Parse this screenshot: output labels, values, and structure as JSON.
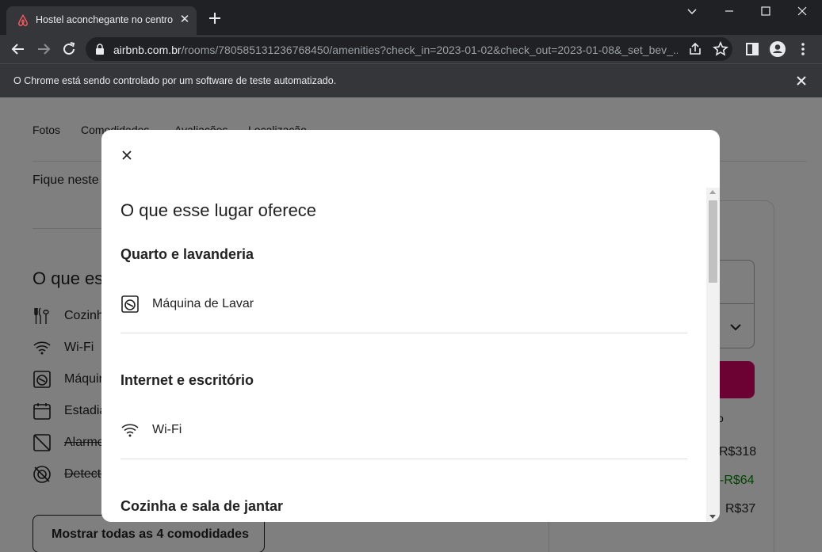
{
  "browser": {
    "tab_title": "Hostel aconchegante no centro h",
    "url_host": "airbnb.com.br",
    "url_path": "/rooms/780585131236768450/amenities?check_in=2023-01-02&check_out=2023-01-08&_set_bev_...",
    "automation_notice": "O Chrome está sendo controlado por um software de teste automatizado."
  },
  "page": {
    "nav": [
      "Fotos",
      "Comodidades",
      "Avaliações",
      "Localização"
    ],
    "intro_text": "Fique neste",
    "section_heading": "O que es",
    "amenities": [
      {
        "icon": "utensils-icon",
        "label": "Cozinha",
        "unavailable": false
      },
      {
        "icon": "wifi-icon",
        "label": "Wi-Fi",
        "unavailable": false
      },
      {
        "icon": "washer-icon",
        "label": "Máquina de Lavar",
        "unavailable": false
      },
      {
        "icon": "calendar-icon",
        "label": "Estadias longas",
        "unavailable": false
      },
      {
        "icon": "alarm-off-icon",
        "label": "Alarme",
        "unavailable": true
      },
      {
        "icon": "detector-off-icon",
        "label": "Detector",
        "unavailable": true
      }
    ],
    "show_all_button": "Mostrar todas as 4 comodidades",
    "booking": {
      "note": "o",
      "price_1": "R$318",
      "discount": "-R$64",
      "price_2": "R$37"
    }
  },
  "modal": {
    "title": "O que esse lugar oferece",
    "sections": [
      {
        "title": "Quarto e lavanderia",
        "items": [
          {
            "icon": "washer-icon",
            "label": "Máquina de Lavar"
          }
        ]
      },
      {
        "title": "Internet e escritório",
        "items": [
          {
            "icon": "wifi-icon",
            "label": "Wi-Fi"
          }
        ]
      },
      {
        "title": "Cozinha e sala de jantar",
        "items": []
      }
    ]
  }
}
